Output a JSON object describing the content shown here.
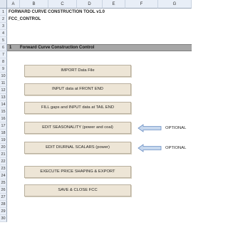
{
  "columns": [
    "A",
    "B",
    "C",
    "D",
    "E",
    "F",
    "G"
  ],
  "rows": [
    "1",
    "2",
    "3",
    "4",
    "5",
    "6",
    "7",
    "8",
    "9",
    "10",
    "11",
    "12",
    "13",
    "14",
    "15",
    "16",
    "17",
    "18",
    "19",
    "20",
    "21",
    "22",
    "23",
    "24",
    "25",
    "26",
    "27",
    "28",
    "29",
    "30"
  ],
  "title": "FORWARD CURVE CONSTRUCTION TOOL v1.0",
  "subtitle": "FCC_CONTROL",
  "section": {
    "number": "1",
    "label": "Forward Curve Construction Control"
  },
  "buttons": {
    "import": "IMPORT Data File",
    "front_end": "INPUT data at FRONT END",
    "tail_end": "FILL gaps and INPUT data at TAIL END",
    "seasonality": "EDIT SEASONALITY (power and coal)",
    "diurnal": "EDIT DIURNAL SCALARS (power)",
    "execute": "EXECUTE PRICE SHAPING & EXPORT",
    "save": "SAVE & CLOSE FCC"
  },
  "optional_label": "OPTIONAL",
  "colors": {
    "header": "#e8eef7",
    "section_bar": "#a6a6a6",
    "button": "#ede5d6",
    "arrow": "#9db6d9"
  }
}
